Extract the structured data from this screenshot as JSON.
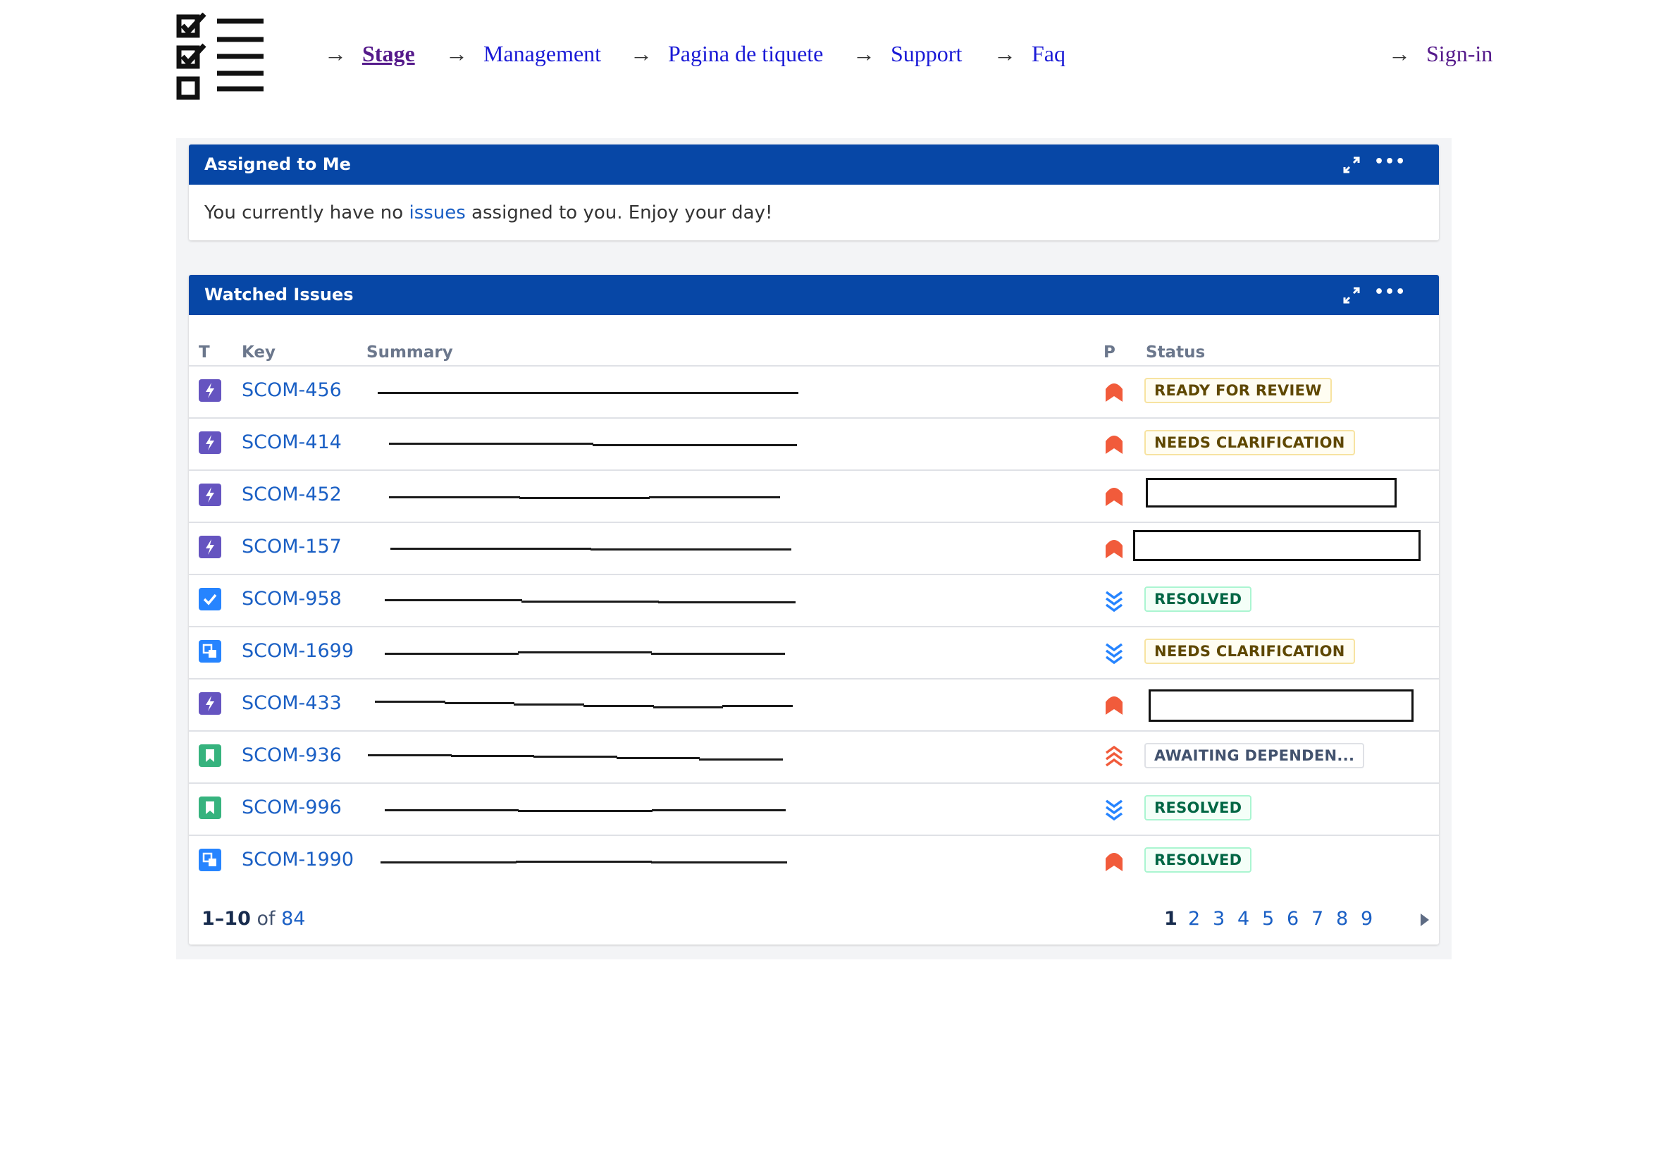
{
  "nav": {
    "items": [
      {
        "label": "Stage"
      },
      {
        "label": "Management"
      },
      {
        "label": "Pagina de tiquete"
      },
      {
        "label": "Support"
      },
      {
        "label": "Faq"
      }
    ],
    "signin": {
      "label": "Sign-in"
    },
    "arrow": "→"
  },
  "assigned": {
    "title": "Assigned to Me",
    "message_pre": "You currently have no ",
    "message_link": "issues",
    "message_post": " assigned to you. Enjoy your day!"
  },
  "watched": {
    "title": "Watched Issues",
    "columns": {
      "t": "T",
      "key": "Key",
      "summary": "Summary",
      "p": "P",
      "status": "Status"
    },
    "rows": [
      {
        "type": "epic",
        "key": "SCOM-456",
        "priority": "high",
        "status": "READY FOR REVIEW",
        "status_color": "yellow"
      },
      {
        "type": "epic",
        "key": "SCOM-414",
        "priority": "high",
        "status": "NEEDS CLARIFICATION",
        "status_color": "yellow"
      },
      {
        "type": "epic",
        "key": "SCOM-452",
        "priority": "high",
        "status": "",
        "status_color": "redacted"
      },
      {
        "type": "epic",
        "key": "SCOM-157",
        "priority": "high",
        "status": "",
        "status_color": "redacted"
      },
      {
        "type": "task",
        "key": "SCOM-958",
        "priority": "lowest",
        "status": "RESOLVED",
        "status_color": "green"
      },
      {
        "type": "subtask",
        "key": "SCOM-1699",
        "priority": "lowest",
        "status": "NEEDS CLARIFICATION",
        "status_color": "yellow"
      },
      {
        "type": "epic",
        "key": "SCOM-433",
        "priority": "high",
        "status": "",
        "status_color": "redacted"
      },
      {
        "type": "story",
        "key": "SCOM-936",
        "priority": "highest",
        "status": "AWAITING DEPENDEN...",
        "status_color": "grey"
      },
      {
        "type": "story",
        "key": "SCOM-996",
        "priority": "lowest",
        "status": "RESOLVED",
        "status_color": "green"
      },
      {
        "type": "subtask",
        "key": "SCOM-1990",
        "priority": "high",
        "status": "RESOLVED",
        "status_color": "green"
      }
    ],
    "footer": {
      "range": "1–10",
      "of": " of ",
      "total": "84",
      "pages": [
        "1",
        "2",
        "3",
        "4",
        "5",
        "6",
        "7",
        "8",
        "9"
      ],
      "current_page": "1"
    }
  },
  "colors": {
    "header_blue": "#0747a6",
    "link_blue": "#1a5fc4",
    "nav_link": "#1a1ad6",
    "visited": "#551a8b",
    "priority_red": "#f15b3b",
    "priority_blue": "#2684ff",
    "epic_purple": "#6554c0",
    "task_blue": "#2684ff",
    "story_green": "#36b37e"
  }
}
